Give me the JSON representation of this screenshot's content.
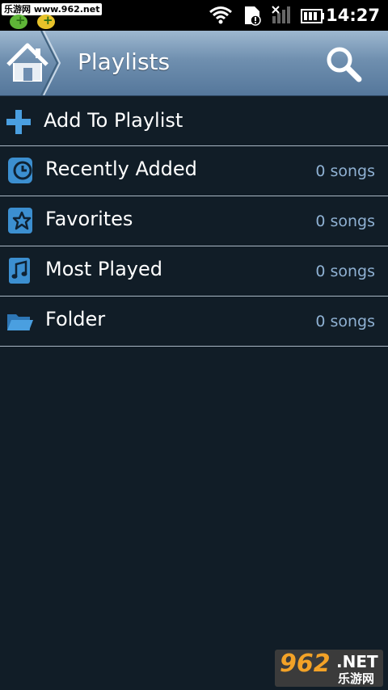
{
  "status_bar": {
    "time": "14:27",
    "watermark": "乐游网 www.962.net"
  },
  "header": {
    "title": "Playlists",
    "home_icon": "home-icon",
    "search_icon": "search-icon"
  },
  "add_row": {
    "label": "Add To Playlist",
    "icon": "plus-icon"
  },
  "playlists": [
    {
      "name": "Recently Added",
      "count": "0 songs",
      "icon": "clock-icon"
    },
    {
      "name": "Favorites",
      "count": "0 songs",
      "icon": "star-icon"
    },
    {
      "name": "Most Played",
      "count": "0 songs",
      "icon": "music-note-icon"
    },
    {
      "name": "Folder",
      "count": "0 songs",
      "icon": "folder-icon"
    }
  ],
  "watermark_bottom": {
    "number": "962",
    "domain": ".NET",
    "site_name": "乐游网"
  },
  "colors": {
    "background": "#111d27",
    "header_top": "#9eb8d0",
    "header_bottom": "#55779b",
    "divider": "#a9b7c4",
    "count_text": "#8fb1d3",
    "icon_blue": "#3c8fd0"
  }
}
